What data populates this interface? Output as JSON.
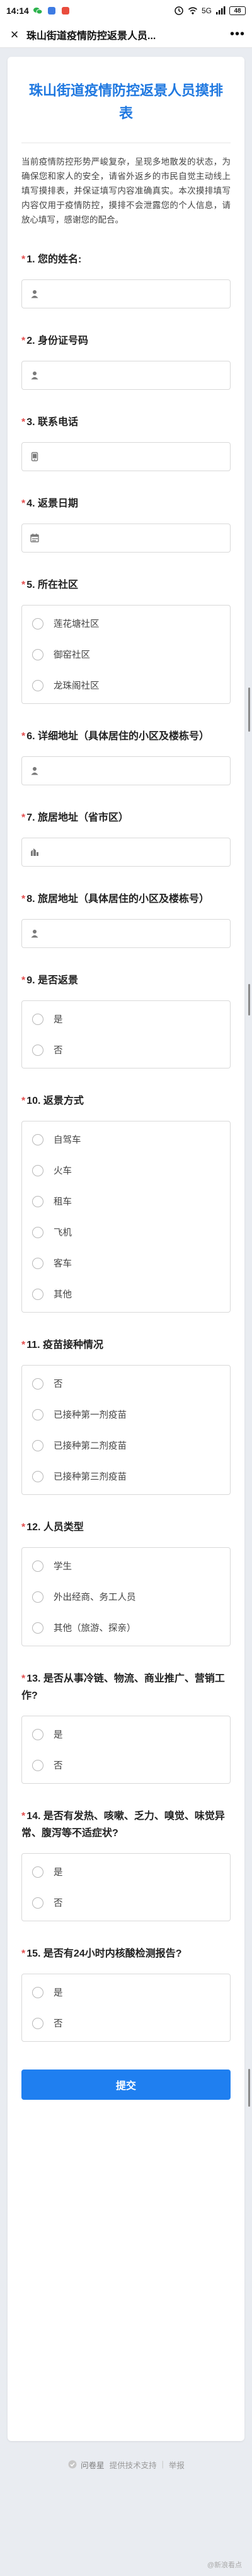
{
  "status_bar": {
    "time": "14:14",
    "battery": "48",
    "network": "5G"
  },
  "title_bar": {
    "title": "珠山街道疫情防控返景人员...",
    "close_glyph": "×",
    "more_glyph": "•••"
  },
  "form": {
    "title": "珠山街道疫情防控返景人员摸排表",
    "intro": "当前疫情防控形势严峻复杂，呈现多地散发的状态，为确保您和家人的安全，请省外返乡的市民自觉主动线上填写摸排表，并保证填写内容准确真实。本次摸排填写内容仅用于疫情防控，摸排不会泄露您的个人信息，请放心填写，感谢您的配合。",
    "required_mark": "*",
    "questions": [
      {
        "title": "1. 您的姓名:",
        "type": "text",
        "icon": "person-icon",
        "value": ""
      },
      {
        "title": "2. 身份证号码",
        "type": "text",
        "icon": "id-card-icon",
        "value": ""
      },
      {
        "title": "3. 联系电话",
        "type": "text",
        "icon": "phone-icon",
        "value": ""
      },
      {
        "title": "4. 返景日期",
        "type": "text",
        "icon": "calendar-icon",
        "value": ""
      },
      {
        "title": "5. 所在社区",
        "type": "radio",
        "options": [
          "莲花塘社区",
          "御窑社区",
          "龙珠阁社区"
        ]
      },
      {
        "title": "6. 详细地址（具体居住的小区及楼栋号）",
        "type": "text",
        "icon": "person-icon",
        "value": ""
      },
      {
        "title": "7. 旅居地址（省市区）",
        "type": "text",
        "icon": "location-icon",
        "value": ""
      },
      {
        "title": "8. 旅居地址（具体居住的小区及楼栋号）",
        "type": "text",
        "icon": "person-icon",
        "value": ""
      },
      {
        "title": "9. 是否返景",
        "type": "radio",
        "options": [
          "是",
          "否"
        ]
      },
      {
        "title": "10. 返景方式",
        "type": "radio",
        "options": [
          "自驾车",
          "火车",
          "租车",
          "飞机",
          "客车",
          "其他"
        ]
      },
      {
        "title": "11. 疫苗接种情况",
        "type": "radio",
        "options": [
          "否",
          "已接种第一剂疫苗",
          "已接种第二剂疫苗",
          "已接种第三剂疫苗"
        ]
      },
      {
        "title": "12. 人员类型",
        "type": "radio",
        "options": [
          "学生",
          "外出经商、务工人员",
          "其他（旅游、探亲）"
        ]
      },
      {
        "title": "13. 是否从事冷链、物流、商业推广、营销工作?",
        "type": "radio",
        "options": [
          "是",
          "否"
        ]
      },
      {
        "title": "14. 是否有发热、咳嗽、乏力、嗅觉、味觉异常、腹泻等不适症状?",
        "type": "radio",
        "options": [
          "是",
          "否"
        ]
      },
      {
        "title": "15. 是否有24小时内核酸检测报告?",
        "type": "radio",
        "options": [
          "是",
          "否"
        ]
      }
    ],
    "submit_label": "提交"
  },
  "footer": {
    "brand": "问卷星",
    "tagline": "提供技术支持",
    "report": "举报"
  },
  "watermark": "@新浪看点"
}
